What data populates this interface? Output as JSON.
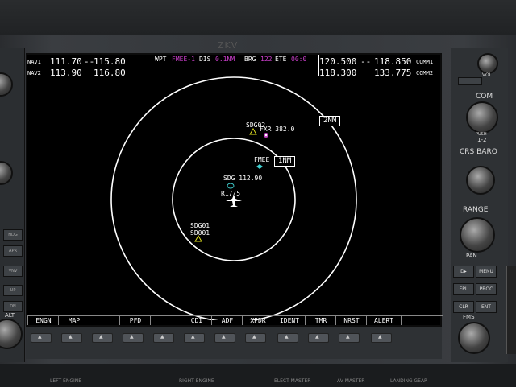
{
  "brand": "ZKV",
  "nav": [
    {
      "label": "NAV1",
      "active": "111.70",
      "arrow": "--",
      "standby": "115.80"
    },
    {
      "label": "NAV2",
      "active": "113.90",
      "arrow": "",
      "standby": "116.80"
    }
  ],
  "com": [
    {
      "active": "120.500",
      "arrow": "--",
      "standby": "118.850",
      "label": "COMM1"
    },
    {
      "active": "118.300",
      "arrow": "",
      "standby": "133.775",
      "label": "COMM2"
    }
  ],
  "top_bar": {
    "wpt_label": "WPT",
    "wpt_value": "FMEE-1",
    "dis_label": "DIS",
    "dis_value": "0.1NM",
    "brg_label": "BRG",
    "brg_value": "122",
    "ete_label": "ETE",
    "ete_value": "00:0"
  },
  "map": {
    "range_inner": "1NM",
    "range_outer": "2NM",
    "waypoints": [
      {
        "id": "sdg02",
        "label": "SDG02"
      },
      {
        "id": "fxr",
        "label": "FXR 382.0"
      },
      {
        "id": "fmee",
        "label": "FMEE"
      },
      {
        "id": "sdg-vor",
        "label": "SDG 112.90"
      },
      {
        "id": "runway",
        "label": "R17/5"
      },
      {
        "id": "sdg01",
        "label": "SDG01"
      },
      {
        "id": "sd001",
        "label": "SD001"
      }
    ],
    "colors": {
      "fxr": "#c040c0",
      "fmee": "#40d0d0",
      "ring": "#ffffff"
    }
  },
  "softkeys": [
    "ENGN",
    "MAP",
    "",
    "PFD",
    "",
    "CDI",
    "ADF",
    "XPDR",
    "IDENT",
    "TMR",
    "NRST",
    "ALERT"
  ],
  "right_panel": {
    "vol_label": "VOL",
    "com_label": "COM",
    "push_label": "PUSH",
    "one_two": "1-2",
    "crs_baro": "CRS  BARO",
    "range_label": "RANGE",
    "pan_label": "PAN",
    "direct": "D▸",
    "menu": "MENU",
    "fpl": "FPL",
    "proc": "PROC",
    "clr": "CLR",
    "ent": "ENT",
    "fms": "FMS"
  },
  "left_panel": {
    "hdg": "HDG",
    "apr": "APR",
    "vnv": "VNV",
    "up": "UP",
    "dn": "DN",
    "alt": "ALT"
  },
  "bottom_labels": [
    "LEFT ENGINE",
    "RIGHT ENGINE",
    "ELECT MASTER",
    "AV MASTER",
    "LANDING GEAR"
  ]
}
